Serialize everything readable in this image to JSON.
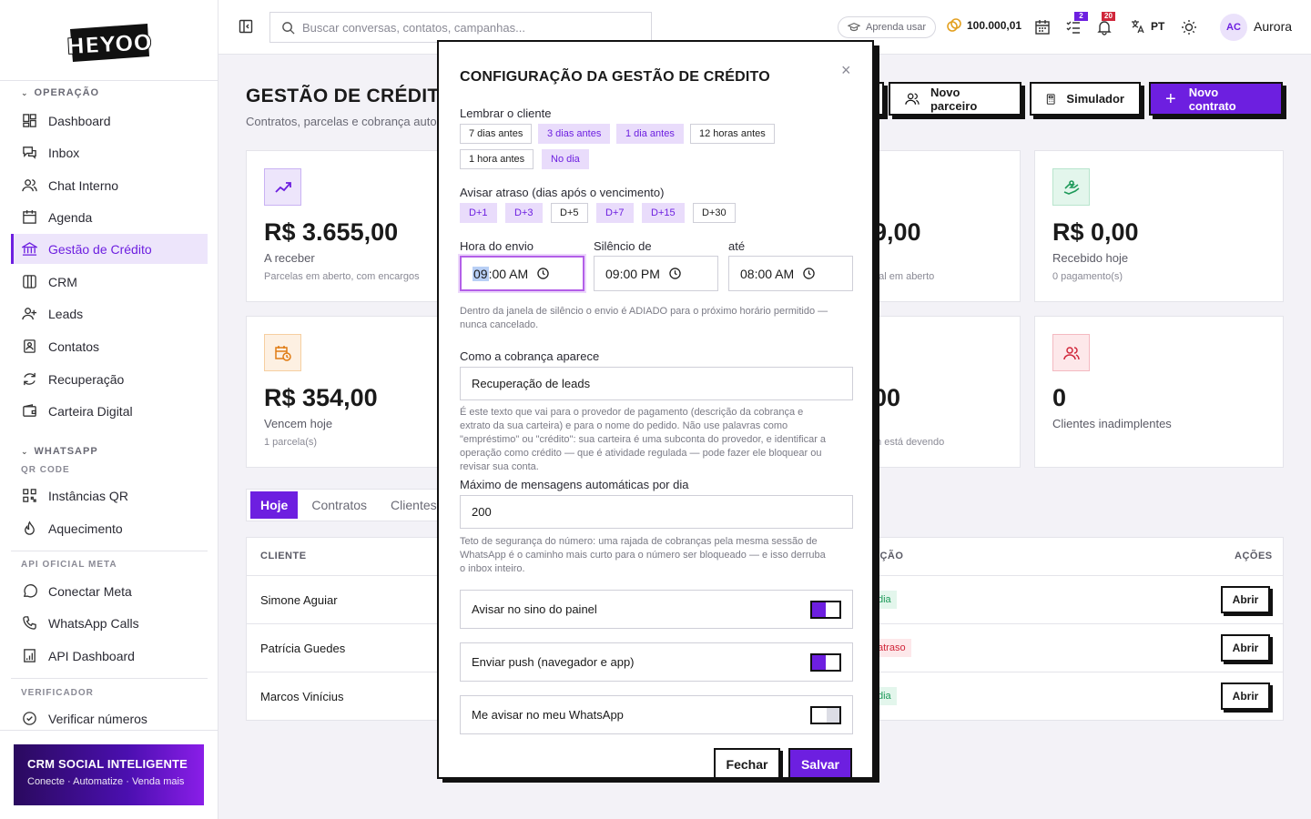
{
  "brand": {
    "logo_text": "HEYOO"
  },
  "sidebar": {
    "sections": {
      "operacao": "OPERAÇÃO",
      "whatsapp": "WHATSAPP",
      "qr_code": "QR CODE",
      "api_meta": "API OFICIAL META",
      "verificador": "VERIFICADOR"
    },
    "items": [
      {
        "label": "Dashboard"
      },
      {
        "label": "Inbox"
      },
      {
        "label": "Chat Interno"
      },
      {
        "label": "Agenda"
      },
      {
        "label": "Gestão de Crédito"
      },
      {
        "label": "CRM"
      },
      {
        "label": "Leads"
      },
      {
        "label": "Contatos"
      },
      {
        "label": "Recuperação"
      },
      {
        "label": "Carteira Digital"
      },
      {
        "label": "Instâncias QR"
      },
      {
        "label": "Aquecimento"
      },
      {
        "label": "Conectar Meta"
      },
      {
        "label": "WhatsApp Calls"
      },
      {
        "label": "API Dashboard"
      },
      {
        "label": "Verificar números"
      }
    ],
    "promo": {
      "title": "CRM SOCIAL INTELIGENTE",
      "subtitle": "Conecte · Automatize · Venda mais"
    }
  },
  "topbar": {
    "search_placeholder": "Buscar conversas, contatos, campanhas...",
    "learn": "Aprenda usar",
    "credits": "100.000,01",
    "tasks_badge": "2",
    "notif_badge": "20",
    "lang": "PT",
    "avatar_initials": "AC",
    "user_name": "Aurora"
  },
  "page": {
    "title": "GESTÃO DE CRÉDITO",
    "subtitle": "Contratos, parcelas e cobrança autom",
    "buttons": {
      "partner": "Novo parceiro",
      "simulator": "Simulador",
      "new_contract": "Novo contrato"
    },
    "cards": [
      {
        "value": "R$ 3.655,00",
        "label": "A receber",
        "sub": "Parcelas em aberto, com encargos"
      },
      {
        "value": "9,00",
        "label": "",
        "sub": "pal em aberto"
      },
      {
        "value": "R$ 0,00",
        "label": "Recebido hoje",
        "sub": "0 pagamento(s)"
      },
      {
        "value": "R$ 354,00",
        "label": "Vencem hoje",
        "sub": "1 parcela(s)"
      },
      {
        "value": "00",
        "label": "",
        "sub": "m está devendo"
      },
      {
        "value": "0",
        "label": "Clientes inadimplentes",
        "sub": ""
      }
    ],
    "tabs": [
      "Hoje",
      "Contratos",
      "Clientes"
    ],
    "table": {
      "headers": {
        "client": "CLIENTE",
        "situation": "AÇÃO",
        "actions": "AÇÕES"
      },
      "rows": [
        {
          "name": "Simone Aguiar",
          "status": "dia",
          "status_kind": "ok",
          "action": "Abrir"
        },
        {
          "name": "Patrícia Guedes",
          "status": "atraso",
          "status_kind": "late",
          "action": "Abrir"
        },
        {
          "name": "Marcos Vinícius",
          "status": "dia",
          "status_kind": "ok",
          "action": "Abrir"
        }
      ]
    }
  },
  "modal": {
    "title": "CONFIGURAÇÃO DA GESTÃO DE CRÉDITO",
    "close": "×",
    "remind_label": "Lembrar o cliente",
    "remind_chips": [
      {
        "label": "7 dias antes",
        "on": false
      },
      {
        "label": "3 dias antes",
        "on": true
      },
      {
        "label": "1 dia antes",
        "on": true
      },
      {
        "label": "12 horas antes",
        "on": false
      },
      {
        "label": "1 hora antes",
        "on": false
      },
      {
        "label": "No dia",
        "on": true
      }
    ],
    "late_label": "Avisar atraso (dias após o vencimento)",
    "late_chips": [
      {
        "label": "D+1",
        "on": true
      },
      {
        "label": "D+3",
        "on": true
      },
      {
        "label": "D+5",
        "on": false
      },
      {
        "label": "D+7",
        "on": true
      },
      {
        "label": "D+15",
        "on": true
      },
      {
        "label": "D+30",
        "on": false
      }
    ],
    "send_time_label": "Hora do envio",
    "send_time_hh": "09",
    "send_time_rest": ":00 AM",
    "silence_from_label": "Silêncio de",
    "silence_from": "09:00 PM",
    "silence_to_label": "até",
    "silence_to": "08:00 AM",
    "silence_help": "Dentro da janela de silêncio o envio é ADIADO para o próximo horário permitido — nunca cancelado.",
    "appear_label": "Como a cobrança aparece",
    "appear_value": "Recuperação de leads",
    "appear_help": "É este texto que vai para o provedor de pagamento (descrição da cobrança e extrato da sua carteira) e para o nome do pedido. Não use palavras como \"empréstimo\" ou \"crédito\": sua carteira é uma subconta do provedor, e identificar a operação como crédito — que é atividade regulada — pode fazer ele bloquear ou revisar sua conta.",
    "max_label": "Máximo de mensagens automáticas por dia",
    "max_value": "200",
    "max_help": "Teto de segurança do número: uma rajada de cobranças pela mesma sessão de WhatsApp é o caminho mais curto para o número ser bloqueado — e isso derruba o inbox inteiro.",
    "toggles": [
      {
        "label": "Avisar no sino do painel",
        "on": true
      },
      {
        "label": "Enviar push (navegador e app)",
        "on": true
      },
      {
        "label": "Me avisar no meu WhatsApp",
        "on": false
      }
    ],
    "close_button": "Fechar",
    "save_button": "Salvar"
  },
  "colors": {
    "accent": "#6d1fe0",
    "ok": "#1e9a5a",
    "late": "#d0263a"
  }
}
